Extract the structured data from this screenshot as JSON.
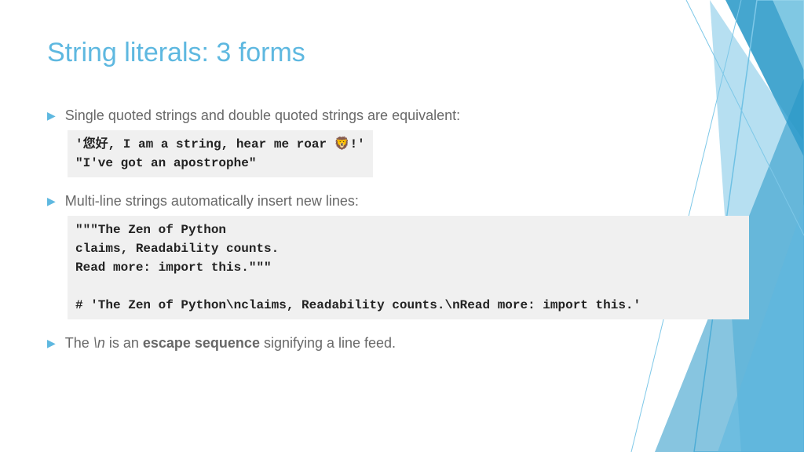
{
  "title": "String literals: 3 forms",
  "bullets": {
    "b1": "Single quoted strings and double quoted strings are equivalent:",
    "b2": "Multi-line strings automatically insert new lines:",
    "b3_prefix": "The ",
    "b3_escape": "\\n",
    "b3_mid": " is an ",
    "b3_bold": "escape sequence",
    "b3_suffix": " signifying a line feed."
  },
  "code": {
    "block1": "'您好, I am a string, hear me roar 🦁!'\n\"I've got an apostrophe\"",
    "block2": "\"\"\"The Zen of Python\nclaims, Readability counts.\nRead more: import this.\"\"\"\n\n# 'The Zen of Python\\nclaims, Readability counts.\\nRead more: import this.'"
  }
}
